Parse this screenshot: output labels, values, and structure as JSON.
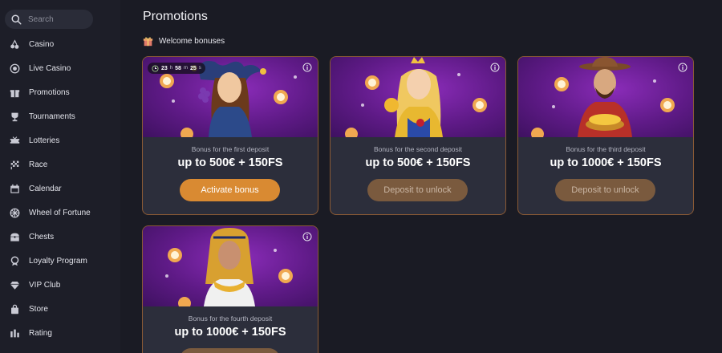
{
  "search": {
    "placeholder": "Search"
  },
  "sidebar": {
    "items": [
      {
        "label": "Casino",
        "icon": "cherries-icon"
      },
      {
        "label": "Live Casino",
        "icon": "chip-icon"
      },
      {
        "label": "Promotions",
        "icon": "gift-icon"
      },
      {
        "label": "Tournaments",
        "icon": "trophy-icon"
      },
      {
        "label": "Lotteries",
        "icon": "ticket-icon"
      },
      {
        "label": "Race",
        "icon": "flag-icon"
      },
      {
        "label": "Calendar",
        "icon": "calendar-icon"
      },
      {
        "label": "Wheel of Fortune",
        "icon": "wheel-icon"
      },
      {
        "label": "Chests",
        "icon": "chest-icon"
      },
      {
        "label": "Loyalty Program",
        "icon": "medal-icon"
      },
      {
        "label": "VIP Club",
        "icon": "diamond-icon"
      },
      {
        "label": "Store",
        "icon": "bag-icon"
      },
      {
        "label": "Rating",
        "icon": "bars-icon"
      }
    ]
  },
  "main": {
    "title": "Promotions",
    "section_label": "Welcome bonuses",
    "timer": {
      "h": "23",
      "h_unit": "h",
      "m": "58",
      "m_unit": "m",
      "s": "25",
      "s_unit": "s"
    },
    "cards": [
      {
        "subtitle": "Bonus for the first deposit",
        "amount": "up to 500€ + 150FS",
        "button": "Activate bonus",
        "state": "active"
      },
      {
        "subtitle": "Bonus for the second deposit",
        "amount": "up to 500€ + 150FS",
        "button": "Deposit to unlock",
        "state": "locked"
      },
      {
        "subtitle": "Bonus for the third deposit",
        "amount": "up to 1000€ + 150FS",
        "button": "Deposit to unlock",
        "state": "locked"
      },
      {
        "subtitle": "Bonus for the fourth deposit",
        "amount": "up to 1000€ + 150FS",
        "button": "",
        "state": "locked"
      }
    ]
  },
  "colors": {
    "accent": "#d98a32",
    "card_border": "#8a5a35",
    "banner": "#6a1f96",
    "bg": "#1a1b24"
  }
}
